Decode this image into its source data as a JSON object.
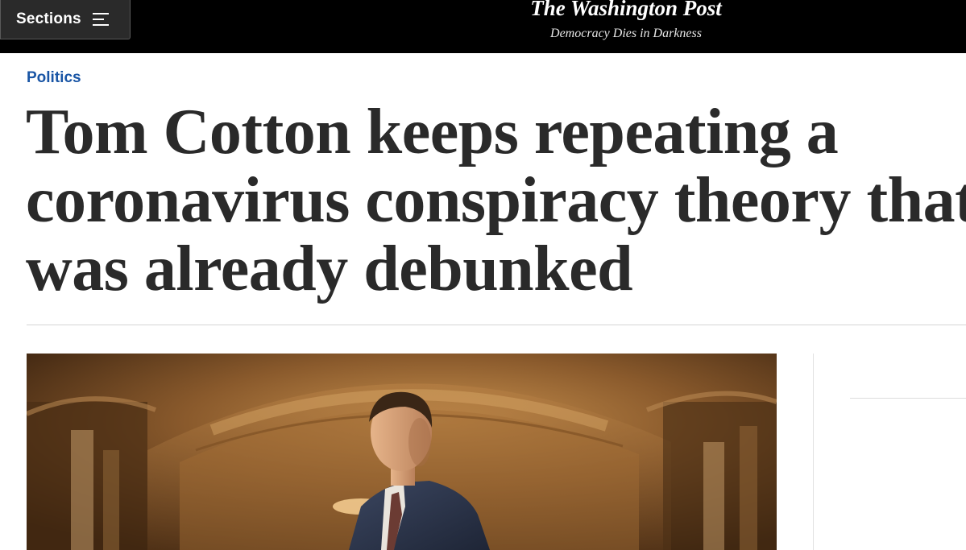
{
  "header": {
    "sections_label": "Sections",
    "logo_text": "The Washington Post",
    "tagline": "Democracy Dies in Darkness"
  },
  "article": {
    "section": "Politics",
    "headline_lines": [
      "Tom Cotton keeps repeating a",
      "coronavirus conspiracy theory that",
      "was already debunked"
    ]
  },
  "icons": {
    "menu": "hamburger-menu-icon"
  },
  "colors": {
    "header_bg": "#000000",
    "section_kicker": "#1955a5",
    "headline_text": "#2a2a2a"
  }
}
